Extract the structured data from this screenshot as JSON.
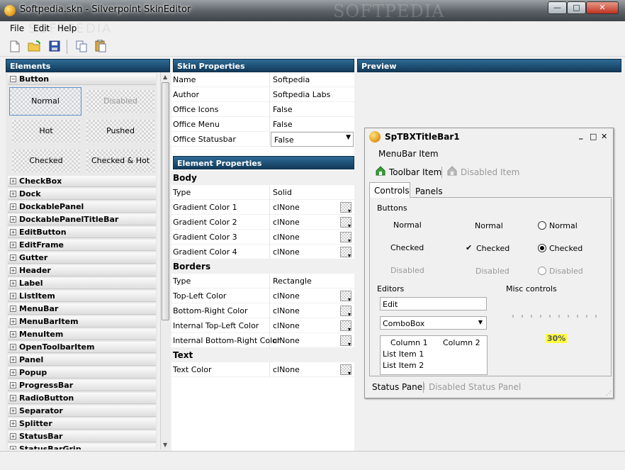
{
  "window": {
    "title": "Softpedia.skn - Silverpoint SkinEditor",
    "watermark": "SOFTPEDIA",
    "controls": {
      "minimize": "—",
      "maximize": "□",
      "close": "✕"
    }
  },
  "menu": {
    "items": [
      "File",
      "Edit",
      "Help"
    ],
    "watermark": "SOFTPEDIA"
  },
  "toolbar": {
    "icons": [
      "new-file-icon",
      "open-folder-icon",
      "save-icon",
      "copy-icon",
      "paste-icon"
    ]
  },
  "panels": {
    "elements": "Elements",
    "skin_properties": "Skin Properties",
    "element_properties": "Element Properties",
    "preview": "Preview"
  },
  "elements": {
    "expanded": "Button",
    "states": [
      "Normal",
      "Disabled",
      "Hot",
      "Pushed",
      "Checked",
      "Checked & Hot"
    ],
    "groups": [
      "CheckBox",
      "Dock",
      "DockablePanel",
      "DockablePanelTitleBar",
      "EditButton",
      "EditFrame",
      "Gutter",
      "Header",
      "Label",
      "ListItem",
      "MenuBar",
      "MenuBarItem",
      "MenuItem",
      "OpenToolbarItem",
      "Panel",
      "Popup",
      "ProgressBar",
      "RadioButton",
      "Separator",
      "Splitter",
      "StatusBar",
      "StatusBarGrip"
    ]
  },
  "skin_properties": [
    {
      "label": "Name",
      "value": "Softpedia"
    },
    {
      "label": "Author",
      "value": "Softpedia Labs"
    },
    {
      "label": "Office Icons",
      "value": "False"
    },
    {
      "label": "Office Menu",
      "value": "False"
    },
    {
      "label": "Office Statusbar",
      "value": "False"
    }
  ],
  "element_properties": {
    "body": {
      "title": "Body",
      "rows": [
        {
          "label": "Type",
          "value": "Solid"
        },
        {
          "label": "Gradient Color 1",
          "value": "clNone"
        },
        {
          "label": "Gradient Color 2",
          "value": "clNone"
        },
        {
          "label": "Gradient Color 3",
          "value": "clNone"
        },
        {
          "label": "Gradient Color 4",
          "value": "clNone"
        }
      ]
    },
    "borders": {
      "title": "Borders",
      "rows": [
        {
          "label": "Type",
          "value": "Rectangle"
        },
        {
          "label": "Top-Left Color",
          "value": "clNone"
        },
        {
          "label": "Bottom-Right Color",
          "value": "clNone"
        },
        {
          "label": "Internal Top-Left Color",
          "value": "clNone"
        },
        {
          "label": "Internal Bottom-Right Color",
          "value": "clNone"
        }
      ]
    },
    "text": {
      "title": "Text",
      "rows": [
        {
          "label": "Text Color",
          "value": "clNone"
        }
      ]
    }
  },
  "preview": {
    "title": "SpTBXTitleBar1",
    "title_controls": {
      "minimize": "_",
      "maximize": "□",
      "close": "✕"
    },
    "menubar_item": "MenuBar Item",
    "toolbar_item": "Toolbar Item",
    "disabled_item": "Disabled Item",
    "tabs": [
      "Controls",
      "Panels"
    ],
    "buttons_label": "Buttons",
    "buttons": {
      "normal": "Normal",
      "checked": "Checked",
      "disabled": "Disabled"
    },
    "editors_label": "Editors",
    "misc_label": "Misc controls",
    "edit_value": "Edit",
    "combo_value": "ComboBox",
    "list": {
      "columns": [
        "Column 1",
        "Column 2"
      ],
      "items": [
        "List Item 1",
        "List Item 2"
      ]
    },
    "progress": "30%",
    "progress_value": 0.3,
    "status_panel": "Status Panel",
    "disabled_status_panel": "Disabled Status Panel"
  }
}
